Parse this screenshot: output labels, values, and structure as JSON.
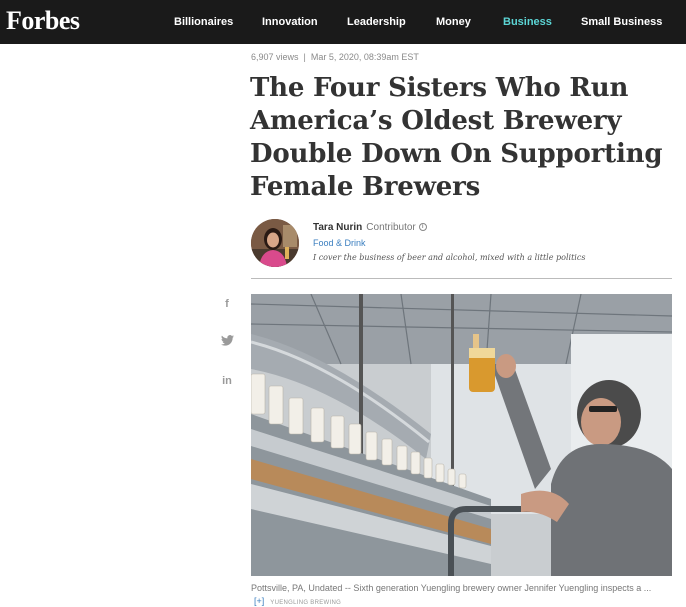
{
  "header": {
    "logo": "Forbes",
    "nav": [
      "Billionaires",
      "Innovation",
      "Leadership",
      "Money",
      "Business",
      "Small Business"
    ],
    "active_nav": "Business",
    "accent_color": "#5cd6d6"
  },
  "article": {
    "views": "6,907 views",
    "separator": "|",
    "date": "Mar 5, 2020, 08:39am EST",
    "headline": "The Four Sisters Who Run America’s Oldest Brewery Double Down On Supporting Female Brewers"
  },
  "author": {
    "name": "Tara Nurin",
    "role": "Contributor",
    "info_symbol": "i",
    "topic": "Food & Drink",
    "bio": "I cover the business of beer and alcohol, mixed with a little politics"
  },
  "share": {
    "facebook": "f",
    "linkedin": "in"
  },
  "image": {
    "caption": "Pottsville, PA, Undated -- Sixth generation Yuengling brewery owner Jennifer Yuengling inspects a ...",
    "expand": "[+]",
    "credit": "YUENGLING BREWING"
  }
}
